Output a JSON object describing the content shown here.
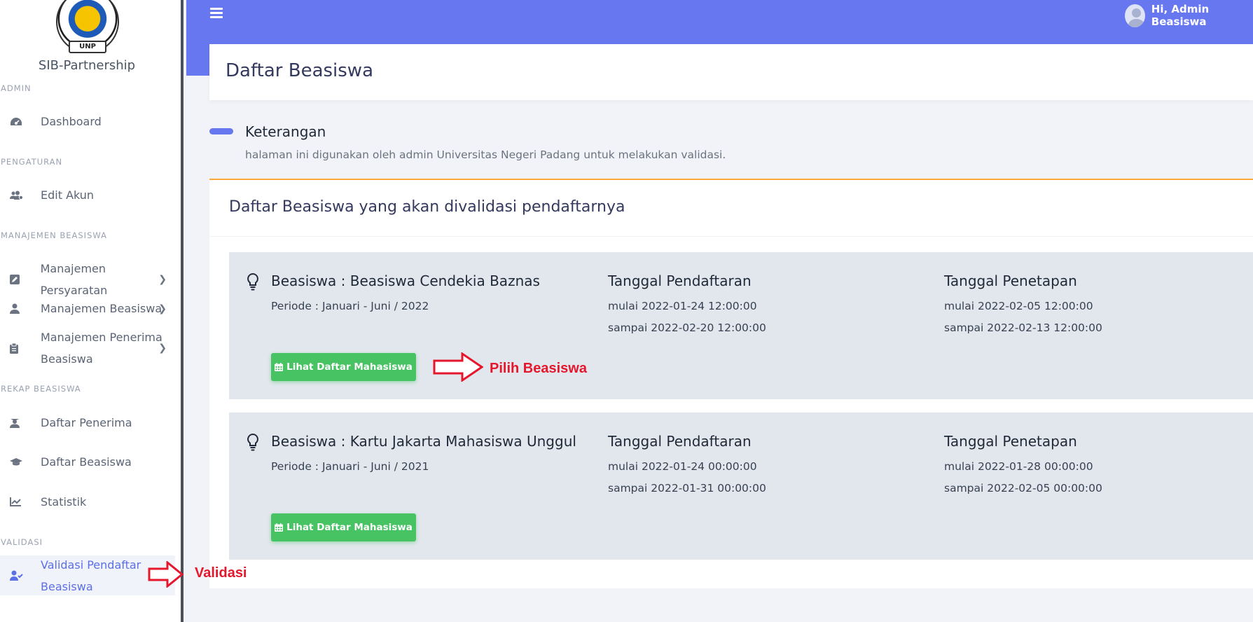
{
  "sidebar": {
    "logo_text": "UNP",
    "brand": "SIB-Partnership",
    "sections": {
      "admin": "ADMIN",
      "pengaturan": "PENGATURAN",
      "manajemen": "MANAJEMEN BEASISWA",
      "rekap": "REKAP BEASISWA",
      "validasi": "VALIDASI"
    },
    "items": {
      "dashboard": "Dashboard",
      "edit_akun": "Edit Akun",
      "persyaratan": "Manajemen Persyaratan",
      "beasiswa": "Manajemen Beasiswa",
      "penerima_1": "Manajemen Penerima",
      "penerima_2": "Beasiswa",
      "daftar_penerima": "Daftar Penerima",
      "daftar_beasiswa": "Daftar Beasiswa",
      "statistik": "Statistik",
      "validasi_1": "Validasi Pendaftar",
      "validasi_2": "Beasiswa"
    }
  },
  "topbar": {
    "user_greeting": "Hi, Admin Beasiswa"
  },
  "page": {
    "title": "Daftar Beasiswa"
  },
  "keterangan": {
    "title": "Keterangan",
    "description": "halaman ini digunakan oleh admin Universitas Negeri Padang untuk melakukan validasi."
  },
  "card": {
    "heading": "Daftar Beasiswa yang akan divalidasi pendaftarnya"
  },
  "scholarships": [
    {
      "title": "Beasiswa : Beasiswa Cendekia Baznas",
      "periode": "Periode : Januari - Juni / 2022",
      "pendaftaran_label": "Tanggal Pendaftaran",
      "pendaftaran_mulai": "mulai 2022-01-24 12:00:00",
      "pendaftaran_sampai": "sampai 2022-02-20 12:00:00",
      "penetapan_label": "Tanggal Penetapan",
      "penetapan_mulai": "mulai 2022-02-05 12:00:00",
      "penetapan_sampai": "sampai 2022-02-13 12:00:00",
      "button": "Lihat Daftar Mahasiswa"
    },
    {
      "title": "Beasiswa : Kartu Jakarta Mahasiswa Unggul",
      "periode": "Periode : Januari - Juni / 2021",
      "pendaftaran_label": "Tanggal Pendaftaran",
      "pendaftaran_mulai": "mulai 2022-01-24 00:00:00",
      "pendaftaran_sampai": "sampai 2022-01-31 00:00:00",
      "penetapan_label": "Tanggal Penetapan",
      "penetapan_mulai": "mulai 2022-01-28 00:00:00",
      "penetapan_sampai": "sampai 2022-02-05 00:00:00",
      "button": "Lihat Daftar Mahasiswa"
    }
  ],
  "annotations": {
    "pilih": "Pilih Beasiswa",
    "validasi": "Validasi",
    "color": "#e5172c"
  },
  "colors": {
    "primary": "#6777ef",
    "success": "#47c363",
    "warning_border": "#fda73b",
    "panel": "#e2e7ee"
  }
}
